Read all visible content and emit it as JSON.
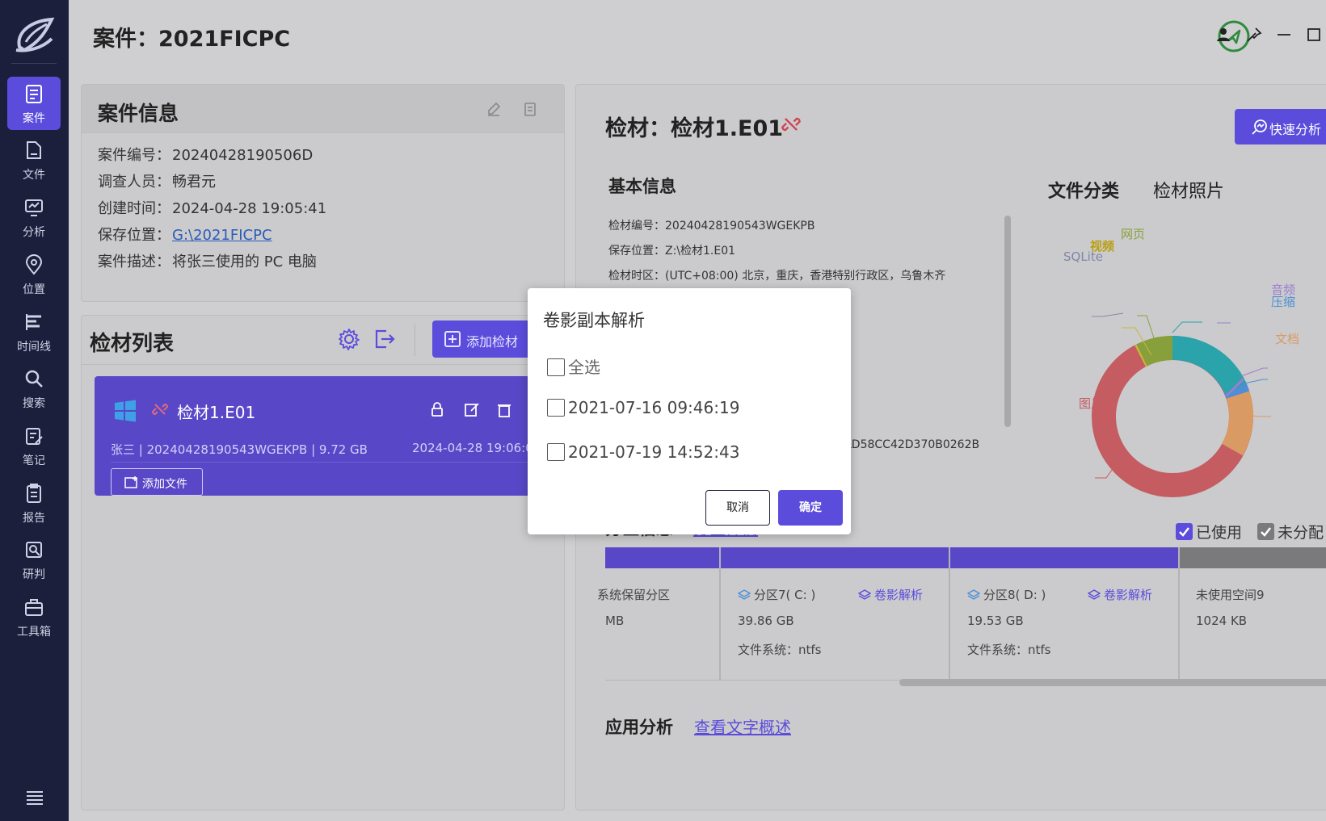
{
  "sidebar": {
    "items": [
      {
        "label": "案件",
        "icon": "case-icon",
        "active": true
      },
      {
        "label": "文件",
        "icon": "file-icon"
      },
      {
        "label": "分析",
        "icon": "analysis-icon"
      },
      {
        "label": "位置",
        "icon": "location-icon"
      },
      {
        "label": "时间线",
        "icon": "timeline-icon"
      },
      {
        "label": "搜索",
        "icon": "search-icon"
      },
      {
        "label": "笔记",
        "icon": "notes-icon"
      },
      {
        "label": "报告",
        "icon": "report-icon"
      },
      {
        "label": "研判",
        "icon": "judge-icon"
      },
      {
        "label": "工具箱",
        "icon": "toolbox-icon"
      }
    ]
  },
  "header": {
    "title": "案件：2021FICPC"
  },
  "case_info": {
    "title": "案件信息",
    "rows": [
      {
        "key": "案件编号：",
        "value": "20240428190506D"
      },
      {
        "key": "调查人员：",
        "value": "畅君元"
      },
      {
        "key": "创建时间：",
        "value": "2024-04-28 19:05:41"
      },
      {
        "key": "保存位置：",
        "value": "G:\\2021FICPC"
      },
      {
        "key": "案件描述：",
        "value": "将张三使用的 PC 电脑"
      }
    ]
  },
  "evidence_list": {
    "title": "检材列表",
    "add_button": "添加检材",
    "card": {
      "name": "检材1.E01",
      "meta": "张三 | 20240428190543WGEKPB | 9.72 GB",
      "date": "2024-04-28 19:06:0",
      "add_file": "添加文件"
    }
  },
  "evidence_detail": {
    "title": "检材：检材1.E01",
    "quick_button": "快速分析",
    "basic_title": "基本信息",
    "basic_rows": [
      "检材编号：20240428190543WGEKPB",
      "保存位置：Z:\\检材1.E01",
      "检材时区：(UTC+08:00) 北京，重庆，香港特别行政区，乌鲁木齐"
    ],
    "hash_tail": "LD58CC42D370B0262B",
    "tabs": [
      "文件分类",
      "检材照片"
    ],
    "pie_labels": [
      "网页",
      "视频",
      "SQLite",
      "音频",
      "压缩",
      "文档",
      "图片"
    ],
    "partition_title": "分区信息",
    "partition_link": "分区详情",
    "legend": [
      "已使用",
      "未分配"
    ],
    "partitions": [
      {
        "name": "系统保留分区",
        "size": "MB"
      },
      {
        "name": "分区7( C: )",
        "size": "39.86 GB",
        "fs": "文件系统：ntfs",
        "shadow": "卷影解析"
      },
      {
        "name": "分区8( D: )",
        "size": "19.53 GB",
        "fs": "文件系统：ntfs",
        "shadow": "卷影解析"
      },
      {
        "name": "未使用空间9",
        "size": "1024 KB"
      }
    ],
    "app_title": "应用分析",
    "app_link": "查看文字概述"
  },
  "dialog": {
    "title": "卷影副本解析",
    "options": [
      "全选",
      "2021-07-16 09:46:19",
      "2021-07-19 14:52:43"
    ],
    "cancel": "取消",
    "ok": "确定"
  },
  "colors": {
    "accent": "#5b4cdc",
    "sidebar": "#1b1f3b",
    "pie": {
      "teal": "#2aa3aa",
      "red": "#c45c61",
      "orange": "#d99a63",
      "olive": "#87a03c",
      "blue": "#4d8fd6",
      "purple": "#9a7fd0"
    }
  }
}
